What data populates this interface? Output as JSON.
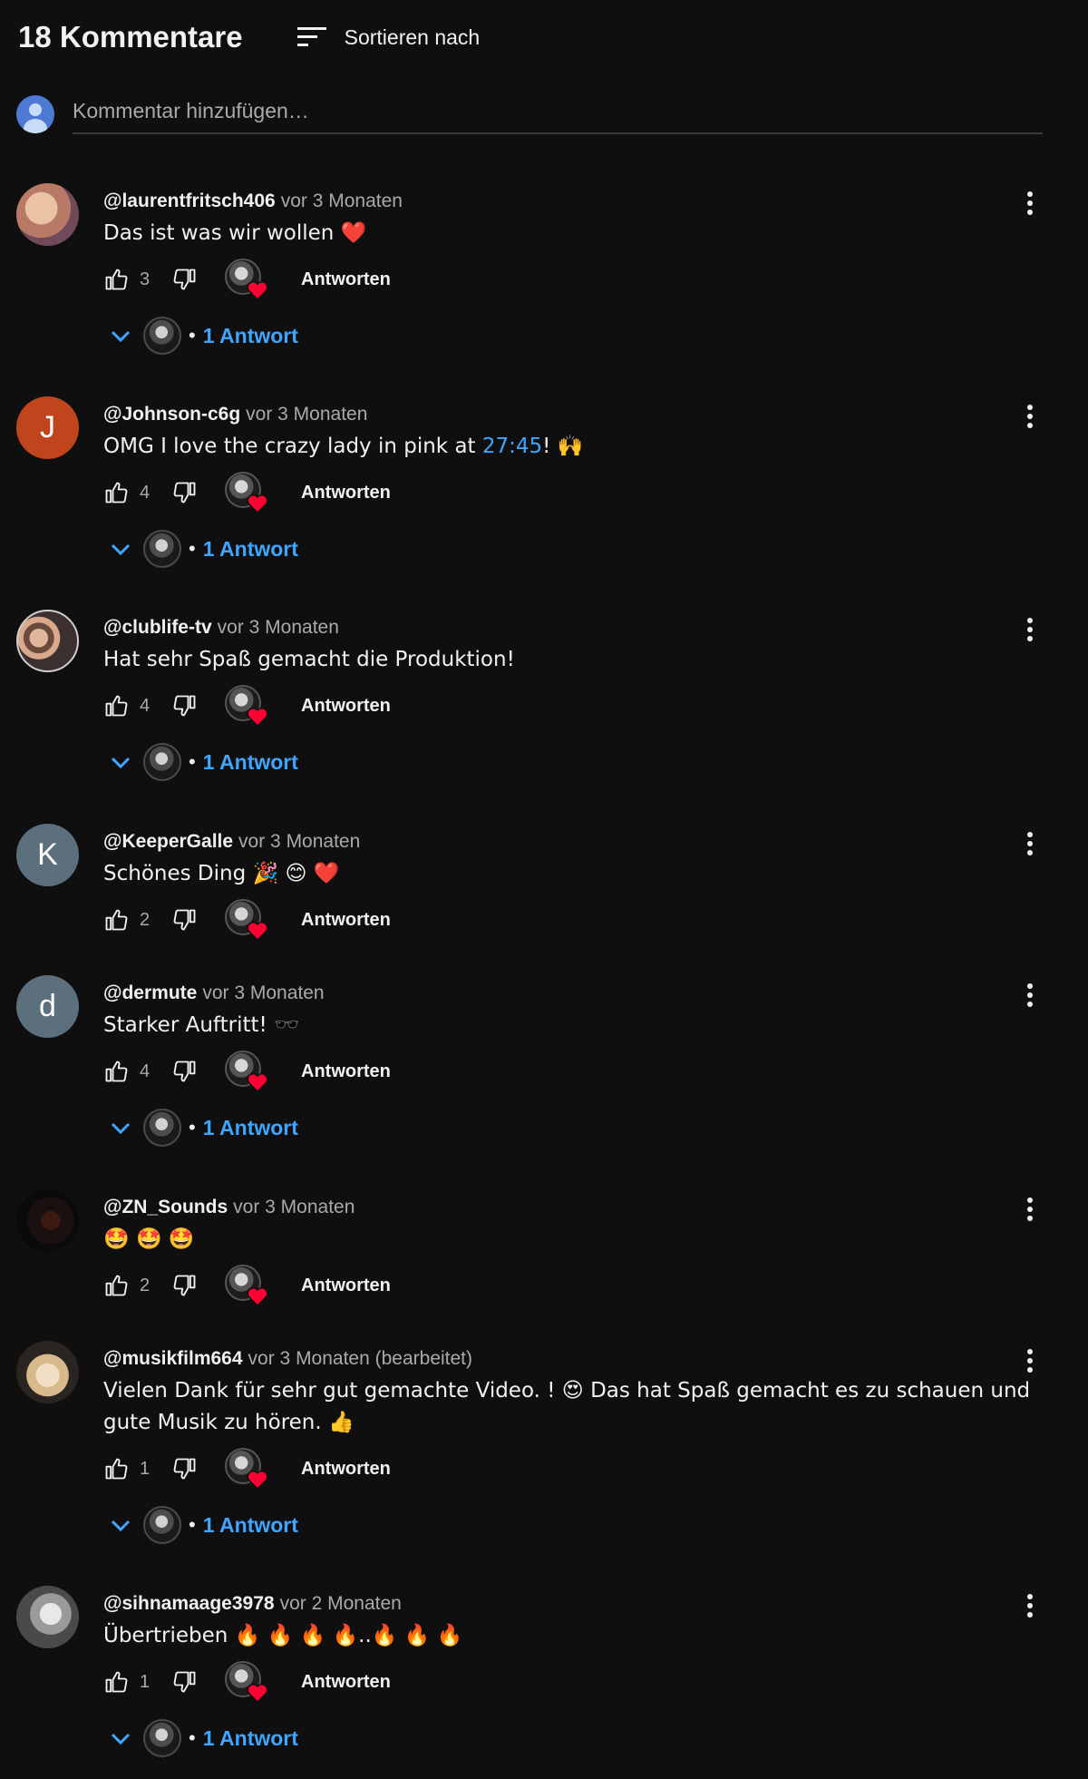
{
  "header": {
    "comment_count": "18 Kommentare",
    "sort_label": "Sortieren nach",
    "sort_icon": "sort-icon"
  },
  "add_comment": {
    "placeholder": "Kommentar hinzufügen…"
  },
  "colors": {
    "background": "#0f0f0f",
    "link": "#3ea6ff",
    "heart": "#ff0033",
    "muted": "#aaaaaa"
  },
  "reply_label": "Antworten",
  "comments": [
    {
      "author": "@laurentfritsch406",
      "time": "vor 3 Monaten",
      "text": "Das ist was wir wollen ❤️",
      "likes": "3",
      "replies": "1 Antwort",
      "avatar_letter": "",
      "avatar_color": "#c9a08a"
    },
    {
      "author": "@Johnson-c6g",
      "time": "vor 3 Monaten",
      "text_before": "OMG I love the crazy lady in pink at ",
      "timestamp": "27:45",
      "text_after": "! 🙌",
      "likes": "4",
      "replies": "1 Antwort",
      "avatar_letter": "J",
      "avatar_color": "#c0441c"
    },
    {
      "author": "@clublife-tv",
      "time": "vor 3 Monaten",
      "text": "Hat sehr Spaß gemacht die Produktion!",
      "likes": "4",
      "replies": "1 Antwort",
      "avatar_letter": "",
      "avatar_color": "#8a6c5e"
    },
    {
      "author": "@KeeperGalle",
      "time": "vor 3 Monaten",
      "text": "Schönes Ding 🎉 😊 ❤️",
      "likes": "2",
      "replies": "",
      "avatar_letter": "K",
      "avatar_color": "#5c6f7d"
    },
    {
      "author": "@dermute",
      "time": "vor 3 Monaten",
      "text": "Starker Auftritt! 🕶️",
      "likes": "4",
      "replies": "1 Antwort",
      "avatar_letter": "d",
      "avatar_color": "#5c6f7d"
    },
    {
      "author": "@ZN_Sounds",
      "time": "vor 3 Monaten",
      "text": "🤩 🤩 🤩",
      "likes": "2",
      "replies": "",
      "avatar_letter": "",
      "avatar_color": "#1a1a1a"
    },
    {
      "author": "@musikfilm664",
      "time": "vor 3 Monaten (bearbeitet)",
      "text": "Vielen Dank für sehr gut gemachte Video. ! 😍 Das hat Spaß gemacht es zu schauen und gute Musik zu hören. 👍",
      "likes": "1",
      "replies": "1 Antwort",
      "avatar_letter": "",
      "avatar_color": "#d9c2a0"
    },
    {
      "author": "@sihnamaage3978",
      "time": "vor 2 Monaten",
      "text": "Übertrieben 🔥 🔥 🔥 🔥..🔥 🔥 🔥",
      "likes": "1",
      "replies": "1 Antwort",
      "avatar_letter": "",
      "avatar_color": "#9a9a9a"
    }
  ]
}
